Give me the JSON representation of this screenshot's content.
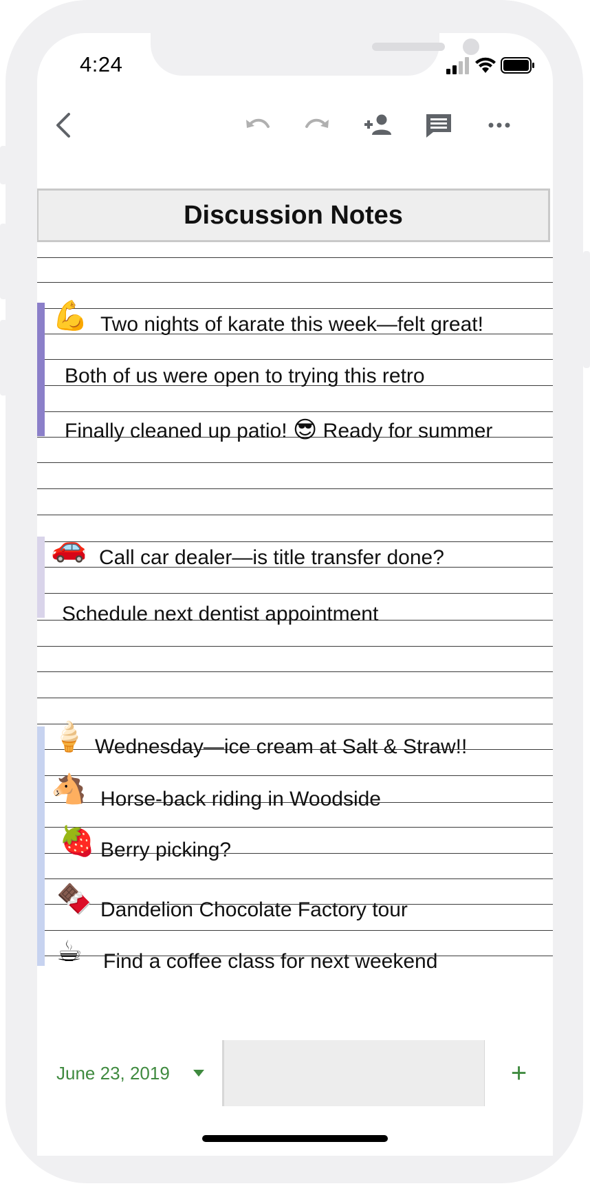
{
  "status_bar": {
    "time": "4:24"
  },
  "toolbar": {
    "icons": [
      "back-icon",
      "undo-icon",
      "redo-icon",
      "add-person-icon",
      "comment-icon",
      "more-icon"
    ]
  },
  "note": {
    "title": "Discussion Notes",
    "groups": [
      {
        "bar_color": "#8b7fc9",
        "items": [
          {
            "emoji": "💪",
            "text": "Two nights of karate this week—felt great!"
          },
          {
            "emoji": "",
            "text": "Both of us were open to trying this retro"
          },
          {
            "emoji": "",
            "text_before": "Finally cleaned up patio! ",
            "inline_emoji": "😎",
            "text_after": " Ready for summer"
          }
        ]
      },
      {
        "bar_color": "#d9d4ea",
        "items": [
          {
            "emoji": "🚗",
            "text": "Call car dealer—is title transfer done?"
          },
          {
            "emoji": "",
            "text": "Schedule next dentist appointment"
          }
        ]
      },
      {
        "bar_color": "#c7d3f0",
        "items": [
          {
            "emoji": "🍦",
            "text": "Wednesday—ice cream at Salt & Straw!!"
          },
          {
            "emoji": "🐴",
            "text": "Horse-back riding in Woodside"
          },
          {
            "emoji": "🍓",
            "text": "Berry picking?"
          },
          {
            "emoji": "🍫",
            "text": "Dandelion Chocolate Factory tour"
          },
          {
            "emoji": "☕",
            "text": "Find a coffee class for next weekend"
          }
        ]
      }
    ]
  },
  "bottom_bar": {
    "date_label": "June 23, 2019",
    "add_label": "+"
  }
}
